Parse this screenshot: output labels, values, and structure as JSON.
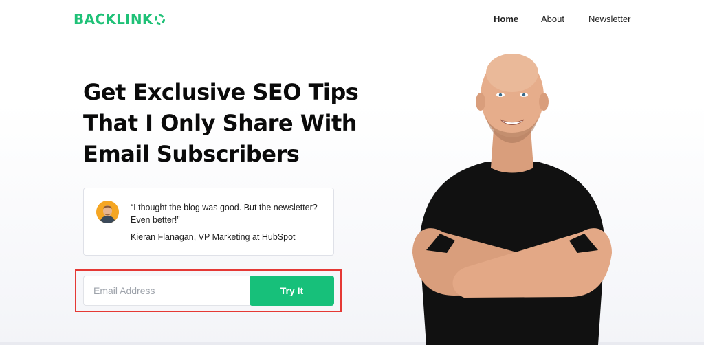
{
  "header": {
    "logo_text": "BACKLINK",
    "nav": {
      "home": "Home",
      "about": "About",
      "newsletter": "Newsletter"
    }
  },
  "hero": {
    "headline_line1": "Get Exclusive SEO Tips",
    "headline_line2": "That I Only Share With",
    "headline_line3": "Email Subscribers"
  },
  "testimonial": {
    "quote_line1": "“I thought the blog was good. But the newsletter?",
    "quote_line2": "Even better!”",
    "author": "Kieran Flanagan, VP Marketing at HubSpot"
  },
  "signup": {
    "email_placeholder": "Email Address",
    "email_value": "",
    "button_label": "Try It"
  },
  "colors": {
    "brand_green": "#1fc177",
    "button_green": "#17c07a",
    "highlight_red": "#e53935"
  }
}
